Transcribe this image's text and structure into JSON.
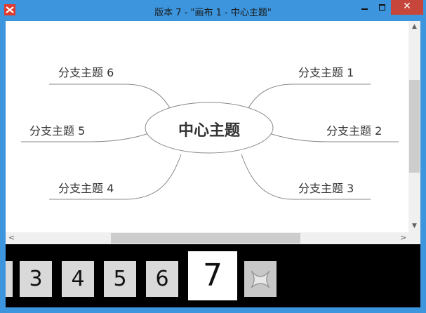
{
  "window": {
    "title": "版本 7 - \"画布 1 - 中心主题\"",
    "close_glyph": "✕"
  },
  "mindmap": {
    "central": "中心主题",
    "branches": [
      "分支主题 1",
      "分支主题 2",
      "分支主题 3",
      "分支主题 4",
      "分支主题 5",
      "分支主题 6"
    ]
  },
  "scrollbars": {
    "up": "▲",
    "down": "▼",
    "left": "<",
    "right": ">"
  },
  "versions": {
    "items": [
      "3",
      "4",
      "5",
      "6",
      "7"
    ],
    "current": "7"
  }
}
